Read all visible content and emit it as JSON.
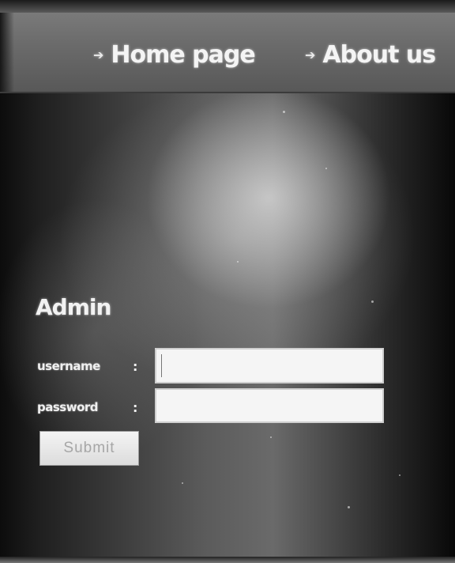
{
  "nav": {
    "items": [
      {
        "label": "Home page"
      },
      {
        "label": "About us"
      }
    ]
  },
  "admin": {
    "title": "Admin",
    "username_label": "username",
    "password_label": "password",
    "colon": ":",
    "username_value": "",
    "password_value": "",
    "submit_label": "Submit"
  },
  "icons": {
    "nav_arrow": "arrow-right-icon"
  }
}
